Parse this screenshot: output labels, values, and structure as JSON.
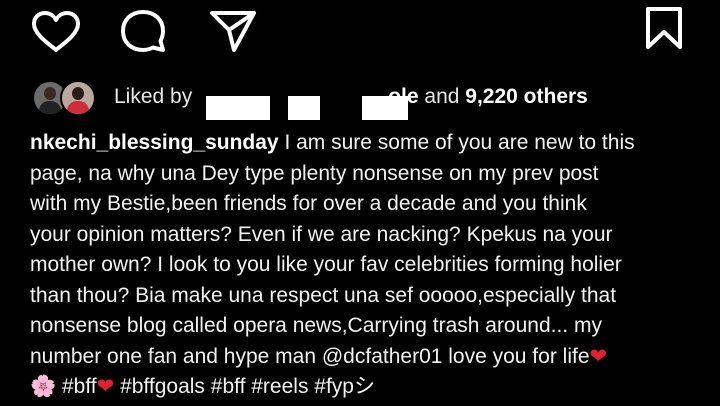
{
  "actions": {
    "like_icon": "heart-outline-icon",
    "comment_icon": "comment-bubble-icon",
    "share_icon": "paper-plane-icon",
    "save_icon": "bookmark-icon"
  },
  "likes": {
    "prefix": "Liked by",
    "partial_name": "ole",
    "connector": "and",
    "others": "9,220 others"
  },
  "caption": {
    "username": "nkechi_blessing_sunday",
    "lines": [
      " I am sure some of you are new to this",
      "page, na why una Dey type plenty nonsense on my prev post",
      "with my Bestie,been friends for over a decade and you think",
      "your opinion matters? Even if we are nacking?  Kpekus na your",
      "mother own? I look to you like your fav celebrities forming holier",
      "than thou? Bia make una respect una sef ooooo,especially that",
      "nonsense blog called opera news,Carrying trash around... my",
      "number one fan and hype man @dcfather01 love you for life"
    ],
    "last_line": " #bff",
    "hashtags_rest": " #bffgoals #bff #reels #fyp",
    "tail": "シ",
    "emoji_heart": "❤",
    "emoji_flower": "🌸"
  },
  "colors": {
    "background": "#000000",
    "text": "#ffffff",
    "heart": "#e0202e"
  }
}
